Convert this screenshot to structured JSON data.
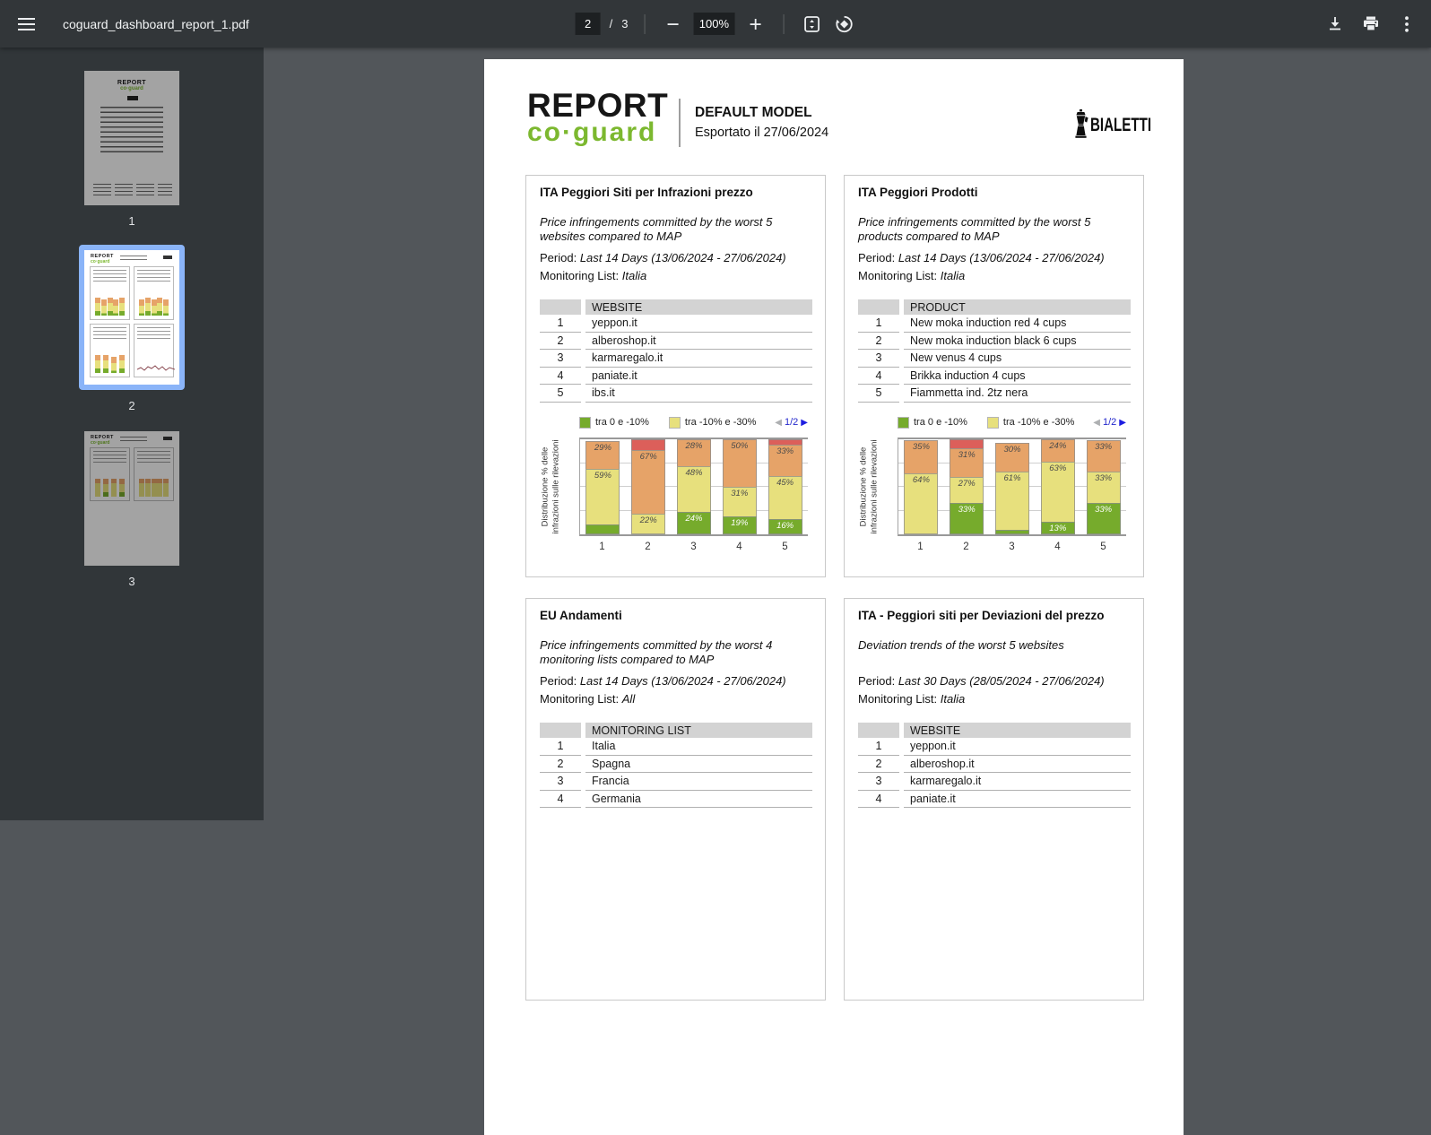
{
  "toolbar": {
    "title": "coguard_dashboard_report_1.pdf",
    "page_current": "2",
    "page_separator": "/",
    "page_total": "3",
    "zoom_value": "100%"
  },
  "sidebar": {
    "pages": [
      {
        "label": "1",
        "selected": false
      },
      {
        "label": "2",
        "selected": true
      },
      {
        "label": "3",
        "selected": false
      }
    ]
  },
  "doc_header": {
    "logo_top": "REPORT",
    "logo_bottom": "co·guard",
    "model_title": "DEFAULT MODEL",
    "exported": "Esportato il 27/06/2024",
    "brand": "BIALETTI"
  },
  "chart_common": {
    "legend": [
      {
        "label": "tra 0 e -10%",
        "color_key": "green"
      },
      {
        "label": "tra -10% e -30%",
        "color_key": "yellow"
      }
    ],
    "pagination": {
      "prev": "◀",
      "label": "1/2",
      "next": "▶"
    },
    "y_label": "Distribuzione % delle\ninfrazioni sulle rilevazioni",
    "x_ticks": [
      "1",
      "2",
      "3",
      "4",
      "5"
    ]
  },
  "colors": {
    "green": "#76ab2c",
    "yellow": "#e7e07d",
    "orange": "#e6a368",
    "red": "#dc5f5a",
    "accent_green": "#7cb82f",
    "selection_blue": "#8ab4f8"
  },
  "panels": [
    {
      "title": "ITA Peggiori Siti per Infrazioni prezzo",
      "description": "Price infringements committed by the worst 5 websites compared to MAP",
      "period_label": "Period: ",
      "period_value": "Last 14 Days (13/06/2024 - 27/06/2024)",
      "list_label": "Monitoring List: ",
      "list_value": "Italia",
      "table": {
        "column": "WEBSITE",
        "rows": [
          {
            "rank": "1",
            "value": "yeppon.it"
          },
          {
            "rank": "2",
            "value": "alberoshop.it"
          },
          {
            "rank": "3",
            "value": "karmaregalo.it"
          },
          {
            "rank": "4",
            "value": "paniate.it"
          },
          {
            "rank": "5",
            "value": "ibs.it"
          }
        ]
      },
      "chart_data": {
        "type": "bar",
        "stacked": true,
        "x": [
          "1",
          "2",
          "3",
          "4",
          "5"
        ],
        "ylim": [
          0,
          100
        ],
        "series": [
          {
            "color_key": "green",
            "values": [
              10,
              0,
              24,
              19,
              16
            ],
            "labels": [
              "",
              "",
              "24%",
              "19%",
              "16%"
            ]
          },
          {
            "color_key": "yellow",
            "values": [
              59,
              22,
              48,
              31,
              45
            ],
            "labels": [
              "59%",
              "22%",
              "48%",
              "31%",
              "45%"
            ]
          },
          {
            "color_key": "orange",
            "values": [
              29,
              67,
              28,
              50,
              33
            ],
            "labels": [
              "29%",
              "67%",
              "28%",
              "50%",
              "33%"
            ]
          },
          {
            "color_key": "red",
            "values": [
              0,
              11,
              0,
              0,
              6
            ],
            "labels": [
              "",
              "",
              "",
              "",
              ""
            ]
          }
        ]
      }
    },
    {
      "title": "ITA Peggiori Prodotti",
      "description": "Price infringements committed by the worst 5 products compared to MAP",
      "period_label": "Period: ",
      "period_value": "Last 14 Days (13/06/2024 - 27/06/2024)",
      "list_label": "Monitoring List: ",
      "list_value": "Italia",
      "table": {
        "column": "PRODUCT",
        "rows": [
          {
            "rank": "1",
            "value": "New moka induction red 4 cups"
          },
          {
            "rank": "2",
            "value": "New moka induction black 6 cups"
          },
          {
            "rank": "3",
            "value": "New venus 4 cups"
          },
          {
            "rank": "4",
            "value": "Brikka induction 4 cups"
          },
          {
            "rank": "5",
            "value": "Fiammetta ind. 2tz nera"
          }
        ]
      },
      "chart_data": {
        "type": "bar",
        "stacked": true,
        "x": [
          "1",
          "2",
          "3",
          "4",
          "5"
        ],
        "ylim": [
          0,
          100
        ],
        "series": [
          {
            "color_key": "green",
            "values": [
              0,
              33,
              5,
              13,
              33
            ],
            "labels": [
              "",
              "33%",
              "",
              "13%",
              "33%"
            ]
          },
          {
            "color_key": "yellow",
            "values": [
              64,
              27,
              61,
              63,
              33
            ],
            "labels": [
              "64%",
              "27%",
              "61%",
              "63%",
              "33%"
            ]
          },
          {
            "color_key": "orange",
            "values": [
              35,
              31,
              30,
              24,
              33
            ],
            "labels": [
              "35%",
              "31%",
              "30%",
              "24%",
              "33%"
            ]
          },
          {
            "color_key": "red",
            "values": [
              0,
              9,
              0,
              0,
              0
            ],
            "labels": [
              "",
              "",
              "",
              "",
              ""
            ]
          }
        ]
      }
    },
    {
      "title": "EU Andamenti",
      "description": "Price infringements committed by the worst 4 monitoring lists compared to MAP",
      "period_label": "Period: ",
      "period_value": "Last 14 Days (13/06/2024 - 27/06/2024)",
      "list_label": "Monitoring List: ",
      "list_value": "All",
      "table": {
        "column": "MONITORING LIST",
        "rows": [
          {
            "rank": "1",
            "value": "Italia"
          },
          {
            "rank": "2",
            "value": "Spagna"
          },
          {
            "rank": "3",
            "value": "Francia"
          },
          {
            "rank": "4",
            "value": "Germania"
          }
        ]
      },
      "chart_data": null
    },
    {
      "title": "ITA - Peggiori siti per Deviazioni del prezzo",
      "description": "Deviation trends of the worst 5 websites",
      "period_label": "Period: ",
      "period_value": "Last 30 Days (28/05/2024 - 27/06/2024)",
      "list_label": "Monitoring List: ",
      "list_value": "Italia",
      "table": {
        "column": "WEBSITE",
        "rows": [
          {
            "rank": "1",
            "value": "yeppon.it"
          },
          {
            "rank": "2",
            "value": "alberoshop.it"
          },
          {
            "rank": "3",
            "value": "karmaregalo.it"
          },
          {
            "rank": "4",
            "value": "paniate.it"
          }
        ]
      },
      "chart_data": null
    }
  ]
}
